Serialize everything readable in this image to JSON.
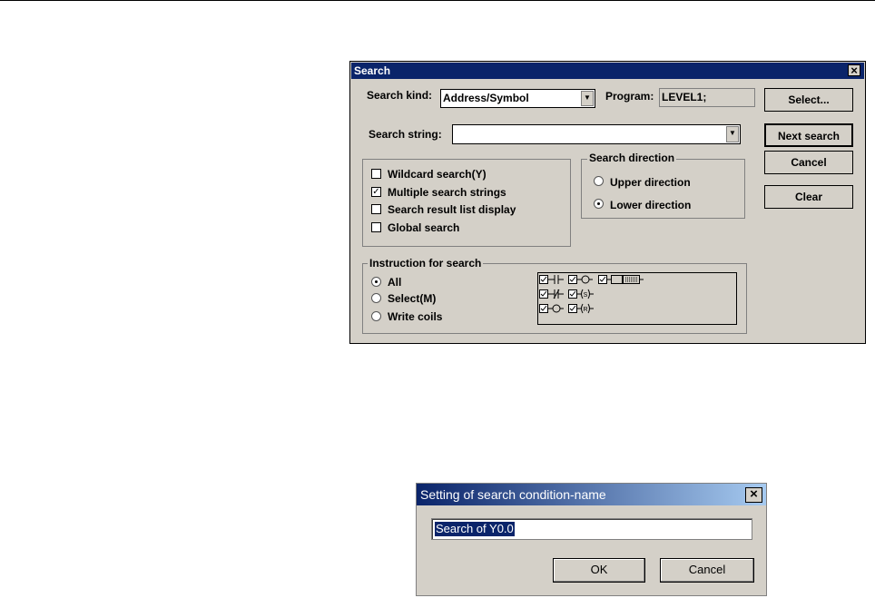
{
  "search_dialog": {
    "title": "Search",
    "search_kind_label": "Search kind:",
    "search_kind_value": "Address/Symbol",
    "program_label": "Program:",
    "program_value": "LEVEL1;",
    "search_string_label": "Search string:",
    "search_string_value": "",
    "buttons": {
      "select": "Select...",
      "next_search": "Next search",
      "cancel": "Cancel",
      "clear": "Clear"
    },
    "options": [
      {
        "label": "Wildcard search(Y)",
        "checked": false
      },
      {
        "label": "Multiple search strings",
        "checked": true
      },
      {
        "label": "Search result list display",
        "checked": false
      },
      {
        "label": "Global search",
        "checked": false
      }
    ],
    "direction": {
      "title": "Search direction",
      "upper": "Upper direction",
      "lower": "Lower direction",
      "selected": "lower"
    },
    "instruction": {
      "title": "Instruction for search",
      "all": "All",
      "select": "Select(M)",
      "write_coils": "Write coils",
      "selected": "all",
      "symbols_row1": [
        "NO contact",
        "coil",
        "function block"
      ],
      "symbols_row2": [
        "NC contact",
        "set coil"
      ],
      "symbols_row3": [
        "output coil",
        "reset coil"
      ],
      "coil_s": "S",
      "coil_r": "R"
    }
  },
  "name_dialog": {
    "title": "Setting of search condition-name",
    "input_value": "Search of Y0.0",
    "ok": "OK",
    "cancel": "Cancel"
  },
  "colors": {
    "titlebar": "#0a246a",
    "dialog_bg": "#d4d0c8",
    "selection": "#0a246a"
  }
}
